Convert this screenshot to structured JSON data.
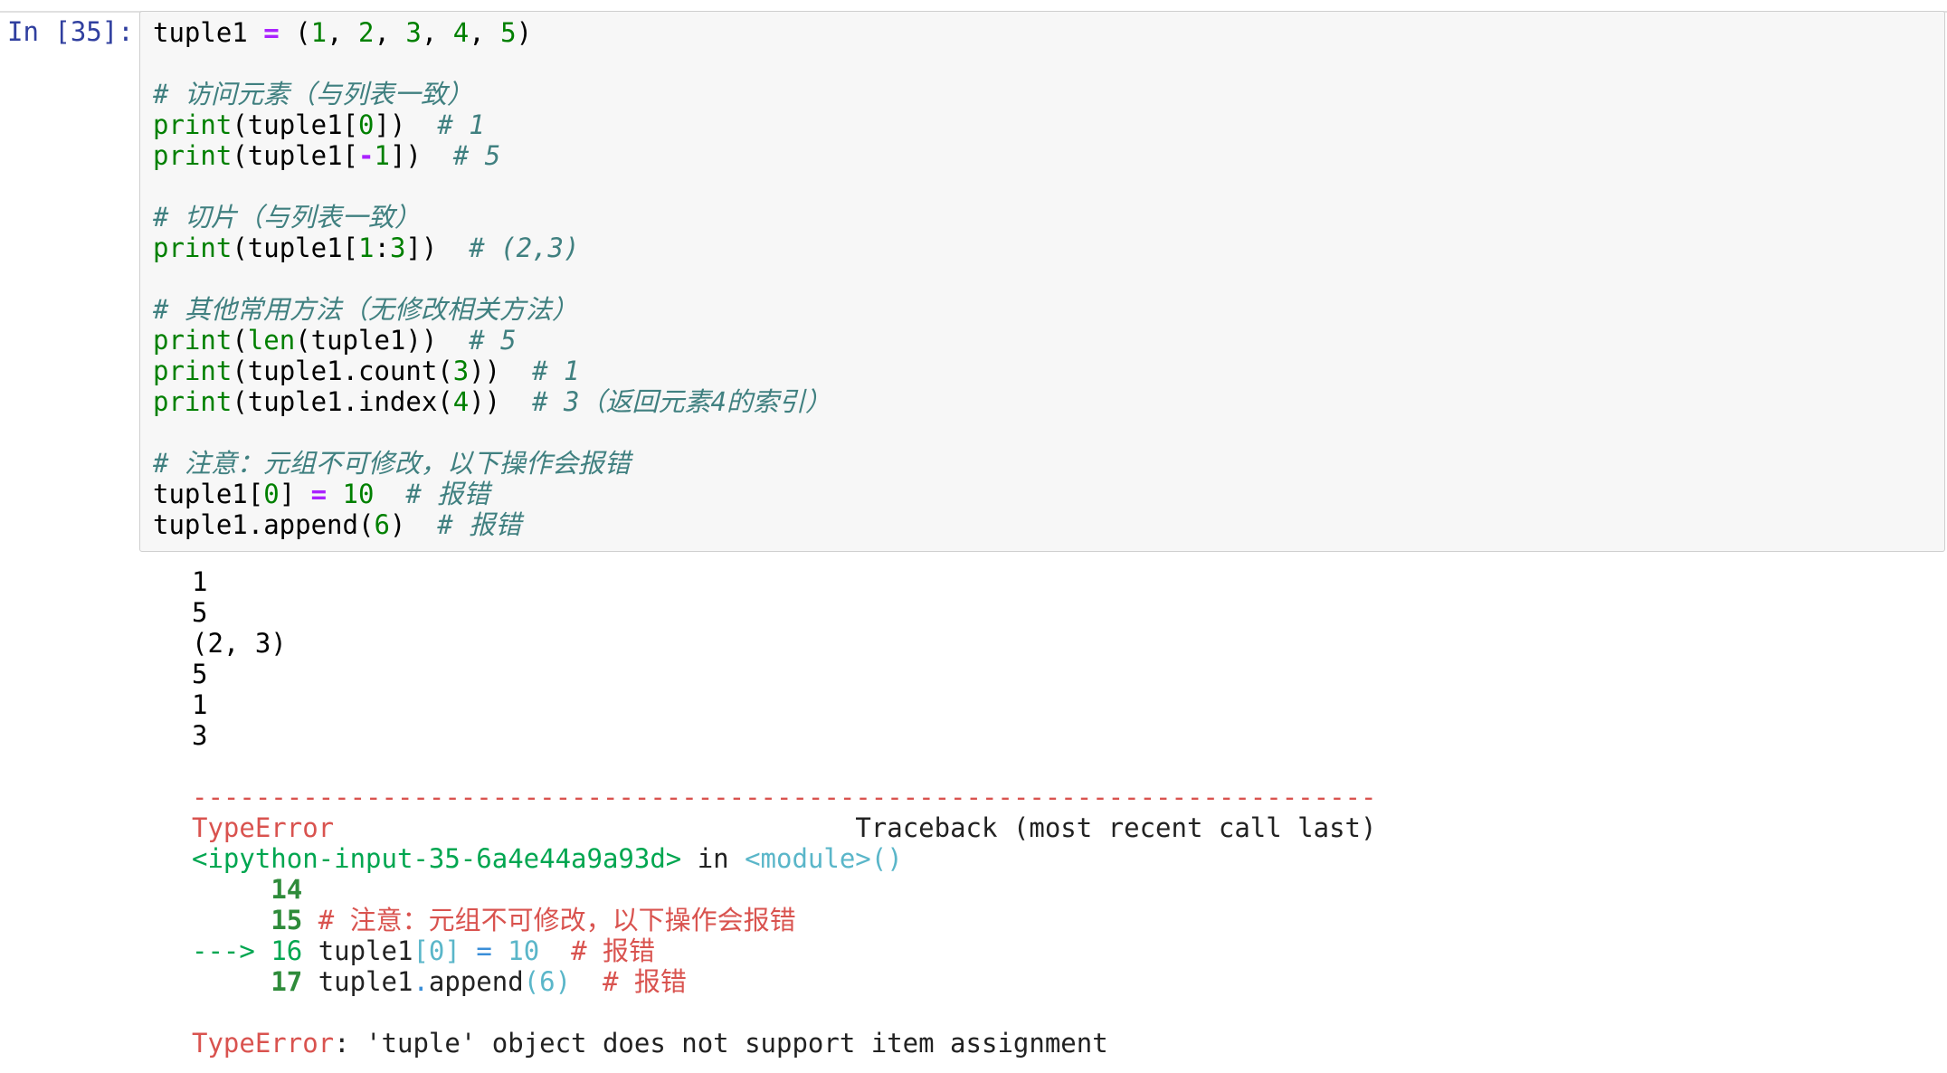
{
  "cell": {
    "prompt": "In [35]:",
    "code_lines": [
      "tuple1 = (1, 2, 3, 4, 5)",
      "",
      "# 访问元素（与列表一致）",
      "print(tuple1[0])  # 1",
      "print(tuple1[-1])  # 5",
      "",
      "# 切片（与列表一致）",
      "print(tuple1[1:3])  # (2,3)",
      "",
      "# 其他常用方法（无修改相关方法）",
      "print(len(tuple1))  # 5",
      "print(tuple1.count(3))  # 1",
      "print(tuple1.index(4))  # 3（返回元素4的索引）",
      "",
      "# 注意：元组不可修改，以下操作会报错",
      "tuple1[0] = 10  # 报错",
      "tuple1.append(6)  # 报错"
    ]
  },
  "output": {
    "stdout_lines": [
      "1",
      "5",
      "(2, 3)",
      "5",
      "1",
      "3"
    ],
    "traceback": {
      "separator": "---------------------------------------------------------------------------",
      "error_type": "TypeError",
      "traceback_header": "Traceback (most recent call last)",
      "input_ref": "<ipython-input-35-6a4e44a9a93d>",
      "in_word": " in ",
      "module_ref": "<module>()",
      "lines": [
        {
          "arrow": "     ",
          "num": "14",
          "code": ""
        },
        {
          "arrow": "     ",
          "num": "15",
          "code": " # 注意：元组不可修改，以下操作会报错"
        },
        {
          "arrow": "---> ",
          "num": "16",
          "code": " tuple1[0] = 10  # 报错"
        },
        {
          "arrow": "     ",
          "num": "17",
          "code": " tuple1.append(6)  # 报错"
        }
      ],
      "final_error_type": "TypeError",
      "final_message": ": 'tuple' object does not support item assignment"
    }
  }
}
